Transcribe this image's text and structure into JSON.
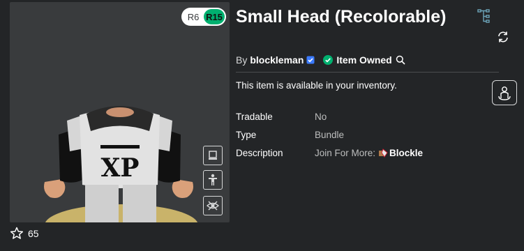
{
  "item": {
    "title": "Small Head (Recolorable)",
    "by_prefix": "By",
    "creator": "blockleman",
    "owned_label": "Item Owned",
    "notice": "This item is available in your inventory."
  },
  "rig": {
    "options": [
      "R6",
      "R15"
    ],
    "selected": "R15"
  },
  "details": [
    {
      "label": "Tradable",
      "value": "No"
    },
    {
      "label": "Type",
      "value": "Bundle"
    },
    {
      "label": "Description",
      "value": "Join For More:",
      "group": "Blockle"
    }
  ],
  "favorites": {
    "count": "65"
  },
  "avatar": {
    "shirt_text": "XP"
  },
  "colors": {
    "background": "#232527",
    "viewer_bg": "#393b3d",
    "accent_green": "#00b06f",
    "verified_blue": "#3b7bff",
    "owned_green": "#00b06f"
  },
  "icons": {
    "rig_toggle": "r6-r15-toggle",
    "verified": "verified-badge-icon",
    "owned": "check-circle-icon",
    "search": "search-icon",
    "tree": "hierarchy-icon",
    "refresh": "refresh-icon",
    "tryon": "try-on-avatar-icon",
    "camera": "camera-view-icon",
    "pose": "pose-figure-icon",
    "hide": "hide-accessories-icon",
    "favorite": "star-icon"
  }
}
